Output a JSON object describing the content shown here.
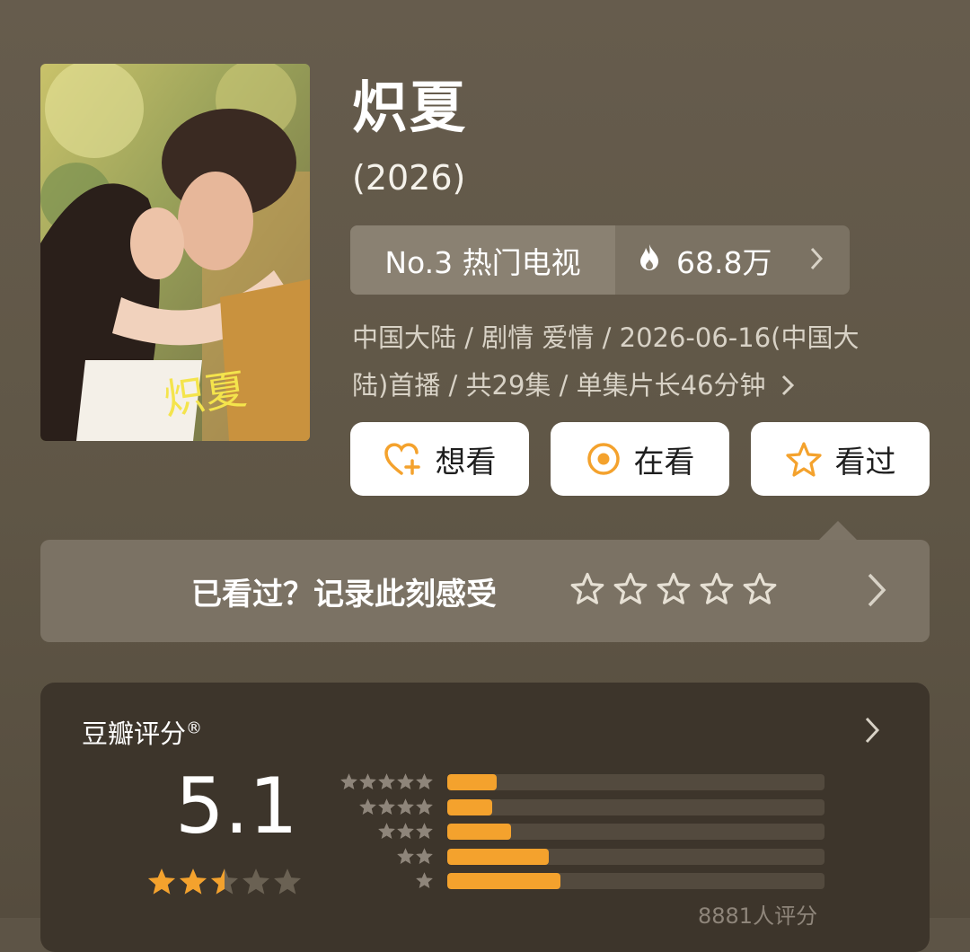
{
  "show": {
    "title": "炽夏",
    "year": "(2026)"
  },
  "rank": {
    "label": "No.3 热门电视",
    "heat": "68.8万"
  },
  "meta": {
    "line1": "中国大陆 / 剧情 爱情 / 2026-06-16(中国大",
    "line2": "陆)首播 / 共29集 / 单集片长46分钟"
  },
  "actions": {
    "want": "想看",
    "watching": "在看",
    "watched": "看过"
  },
  "record": {
    "label": "已看过？记录此刻感受",
    "stars": 5
  },
  "rating": {
    "label": "豆瓣评分",
    "mark": "®",
    "score": "5.1",
    "score_stars": 2.5,
    "distribution": [
      {
        "stars": 5,
        "fraction": 0.13
      },
      {
        "stars": 4,
        "fraction": 0.12
      },
      {
        "stars": 3,
        "fraction": 0.17
      },
      {
        "stars": 2,
        "fraction": 0.27
      },
      {
        "stars": 1,
        "fraction": 0.3
      }
    ],
    "count": "8881人评分"
  },
  "colors": {
    "accent": "#f4a22d",
    "background": "#5f5646",
    "card": "#3d352b"
  },
  "icons": {
    "heat": "flame-icon",
    "want": "heart-plus-icon",
    "watching": "target-circle-icon",
    "watched": "star-outline-icon",
    "chevron": "chevron-right-icon"
  }
}
